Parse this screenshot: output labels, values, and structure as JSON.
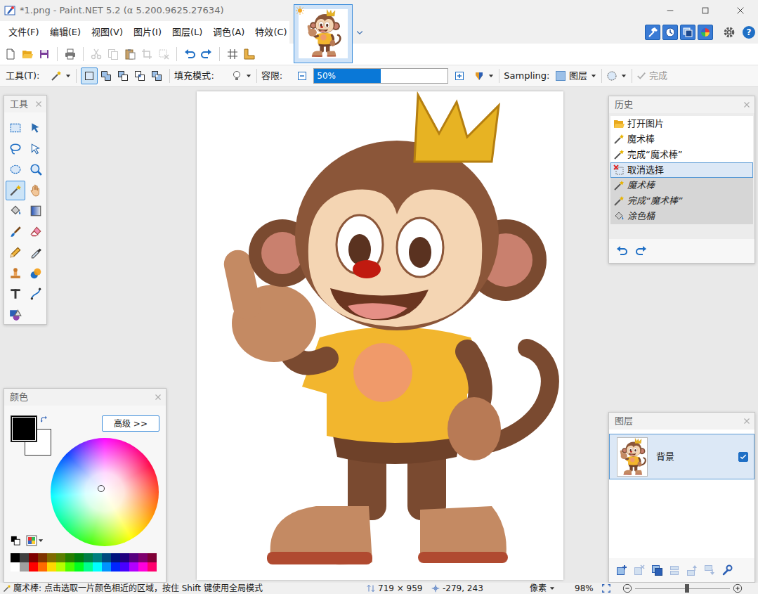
{
  "window": {
    "title": "*1.png - Paint.NET 5.2 (α 5.200.9625.27634)"
  },
  "menu": [
    "文件(F)",
    "编辑(E)",
    "视图(V)",
    "图片(I)",
    "图层(L)",
    "调色(A)",
    "特效(C)"
  ],
  "image_tabs": [
    {
      "selected": true
    }
  ],
  "panel_toggles": [
    {
      "kind": "tools",
      "on": true
    },
    {
      "kind": "history",
      "on": true
    },
    {
      "kind": "layers",
      "on": true
    },
    {
      "kind": "colors",
      "on": true
    }
  ],
  "help_label": "?",
  "toolbar": [
    {
      "kind": "new",
      "disabled": false
    },
    {
      "kind": "open",
      "disabled": false
    },
    {
      "kind": "save",
      "disabled": false
    },
    {
      "kind": "print",
      "disabled": false
    },
    {
      "kind": "cut",
      "disabled": true
    },
    {
      "kind": "copy",
      "disabled": true
    },
    {
      "kind": "paste",
      "disabled": false
    },
    {
      "kind": "crop",
      "disabled": true
    },
    {
      "kind": "deselect",
      "disabled": true
    },
    {
      "kind": "undo",
      "disabled": false
    },
    {
      "kind": "redo",
      "disabled": false
    },
    {
      "kind": "grid",
      "disabled": false
    },
    {
      "kind": "ruler",
      "disabled": false
    }
  ],
  "tool_options": {
    "tool_label": "工具(T):",
    "current_tool": {
      "kind": "magic-wand"
    },
    "selection_modes": [
      {
        "kind": "replace",
        "selected": true
      },
      {
        "kind": "union",
        "selected": false
      },
      {
        "kind": "exclude",
        "selected": false
      },
      {
        "kind": "intersect",
        "selected": false
      },
      {
        "kind": "xor",
        "selected": false
      }
    ],
    "fill_label": "填充模式:",
    "tolerance_label": "容限:",
    "tolerance": {
      "reading": "50%",
      "level": 0.5
    },
    "sampling_label": "Sampling:",
    "sampling_value": "图层",
    "finish": {
      "label": "完成",
      "disabled": true
    }
  },
  "tools_panel": {
    "title": "工具",
    "tools": [
      {
        "kind": "rect-select",
        "selected": false
      },
      {
        "kind": "move-selected",
        "selected": false
      },
      {
        "kind": "lasso",
        "selected": false
      },
      {
        "kind": "move-selection",
        "selected": false
      },
      {
        "kind": "ellipse",
        "selected": false
      },
      {
        "kind": "zoom",
        "selected": false
      },
      {
        "kind": "magic-wand",
        "selected": true
      },
      {
        "kind": "pan",
        "selected": false
      },
      {
        "kind": "bucket",
        "selected": false
      },
      {
        "kind": "gradient",
        "selected": false
      },
      {
        "kind": "brush",
        "selected": false
      },
      {
        "kind": "eraser",
        "selected": false
      },
      {
        "kind": "pencil",
        "selected": false
      },
      {
        "kind": "picker",
        "selected": false
      },
      {
        "kind": "stamp",
        "selected": false
      },
      {
        "kind": "recolor",
        "selected": false
      },
      {
        "kind": "text",
        "selected": false
      },
      {
        "kind": "line",
        "selected": false
      },
      {
        "kind": "shapes",
        "selected": false
      }
    ]
  },
  "history_panel": {
    "title": "历史",
    "items": [
      {
        "label": "打开图片",
        "kind": "open",
        "selected": false,
        "undone": false
      },
      {
        "label": "魔术棒",
        "kind": "wand",
        "selected": false,
        "undone": false
      },
      {
        "label": "完成“魔术棒”",
        "kind": "wand",
        "selected": false,
        "undone": false
      },
      {
        "label": "取消选择",
        "kind": "deselect",
        "selected": true,
        "undone": false
      },
      {
        "label": "魔术棒",
        "kind": "wand",
        "selected": false,
        "undone": true
      },
      {
        "label": "完成“魔术棒”",
        "kind": "wand",
        "selected": false,
        "undone": true
      },
      {
        "label": "涂色桶",
        "kind": "bucket",
        "selected": false,
        "undone": true
      }
    ]
  },
  "colors_panel": {
    "title": "颜色",
    "more_button": "高级 >>",
    "primary": {
      "color": "#000000"
    },
    "secondary": {
      "color": "#ffffff"
    },
    "palette": [
      {
        "color": "#000000"
      },
      {
        "color": "#404040"
      },
      {
        "color": "#7f0000"
      },
      {
        "color": "#7f3300"
      },
      {
        "color": "#7f6a00"
      },
      {
        "color": "#5b7f00"
      },
      {
        "color": "#267f00"
      },
      {
        "color": "#007f0e"
      },
      {
        "color": "#007f46"
      },
      {
        "color": "#007f7f"
      },
      {
        "color": "#004a7f"
      },
      {
        "color": "#00137f"
      },
      {
        "color": "#21007f"
      },
      {
        "color": "#57007f"
      },
      {
        "color": "#7f006e"
      },
      {
        "color": "#7f0037"
      },
      {
        "color": "#ffffff"
      },
      {
        "color": "#a0a0a0"
      },
      {
        "color": "#ff0000"
      },
      {
        "color": "#ff6a00"
      },
      {
        "color": "#ffd800"
      },
      {
        "color": "#b6ff00"
      },
      {
        "color": "#4cff00"
      },
      {
        "color": "#00ff21"
      },
      {
        "color": "#00ff90"
      },
      {
        "color": "#00ffff"
      },
      {
        "color": "#0094ff"
      },
      {
        "color": "#0026ff"
      },
      {
        "color": "#4800ff"
      },
      {
        "color": "#b200ff"
      },
      {
        "color": "#ff00dc"
      },
      {
        "color": "#ff006e"
      }
    ]
  },
  "layers_panel": {
    "title": "图层",
    "layers": [
      {
        "name": "背景",
        "visible": true,
        "selected": true
      }
    ],
    "toolbar": [
      {
        "kind": "add",
        "disabled": false
      },
      {
        "kind": "delete",
        "disabled": true
      },
      {
        "kind": "duplicate",
        "disabled": false
      },
      {
        "kind": "merge",
        "disabled": true
      },
      {
        "kind": "up",
        "disabled": true
      },
      {
        "kind": "down",
        "disabled": true
      },
      {
        "kind": "properties",
        "disabled": false
      }
    ]
  },
  "status_bar": {
    "hint": "魔术棒: 点击选取一片颜色相近的区域，按住 Shift 键使用全局模式",
    "image_size": "719 × 959",
    "cursor_position": "-279, 243",
    "units": "像素",
    "zoom": "98%",
    "zoom_level": 0.55
  }
}
